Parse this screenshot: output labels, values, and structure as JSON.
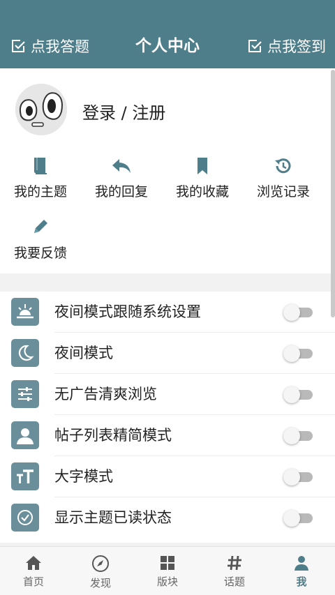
{
  "header": {
    "left_button": "点我答题",
    "title": "个人中心",
    "right_button": "点我签到"
  },
  "profile": {
    "login_text": "登录 / 注册"
  },
  "shortcuts": [
    {
      "label": "我的主题",
      "icon": "book-icon"
    },
    {
      "label": "我的回复",
      "icon": "reply-icon"
    },
    {
      "label": "我的收藏",
      "icon": "bookmark-icon"
    },
    {
      "label": "浏览记录",
      "icon": "history-icon"
    },
    {
      "label": "我要反馈",
      "icon": "pencil-icon"
    }
  ],
  "settings": [
    {
      "label": "夜间模式跟随系统设置",
      "icon": "sunset-icon",
      "on": false
    },
    {
      "label": "夜间模式",
      "icon": "moon-icon",
      "on": false
    },
    {
      "label": "无广告清爽浏览",
      "icon": "sliders-icon",
      "on": false
    },
    {
      "label": "帖子列表精简模式",
      "icon": "user-silhouette-icon",
      "on": false
    },
    {
      "label": "大字模式",
      "icon": "text-size-icon",
      "on": false
    },
    {
      "label": "显示主题已读状态",
      "icon": "check-circle-icon",
      "on": false
    }
  ],
  "tabs": [
    {
      "label": "首页",
      "icon": "home-icon",
      "active": false
    },
    {
      "label": "发现",
      "icon": "compass-icon",
      "active": false
    },
    {
      "label": "版块",
      "icon": "grid-icon",
      "active": false
    },
    {
      "label": "话题",
      "icon": "hash-icon",
      "active": false
    },
    {
      "label": "我",
      "icon": "person-icon",
      "active": true
    }
  ],
  "colors": {
    "accent": "#4f7e8b",
    "icon_bg": "#6a8f9a",
    "toggle_off": "#b9b9b9"
  }
}
